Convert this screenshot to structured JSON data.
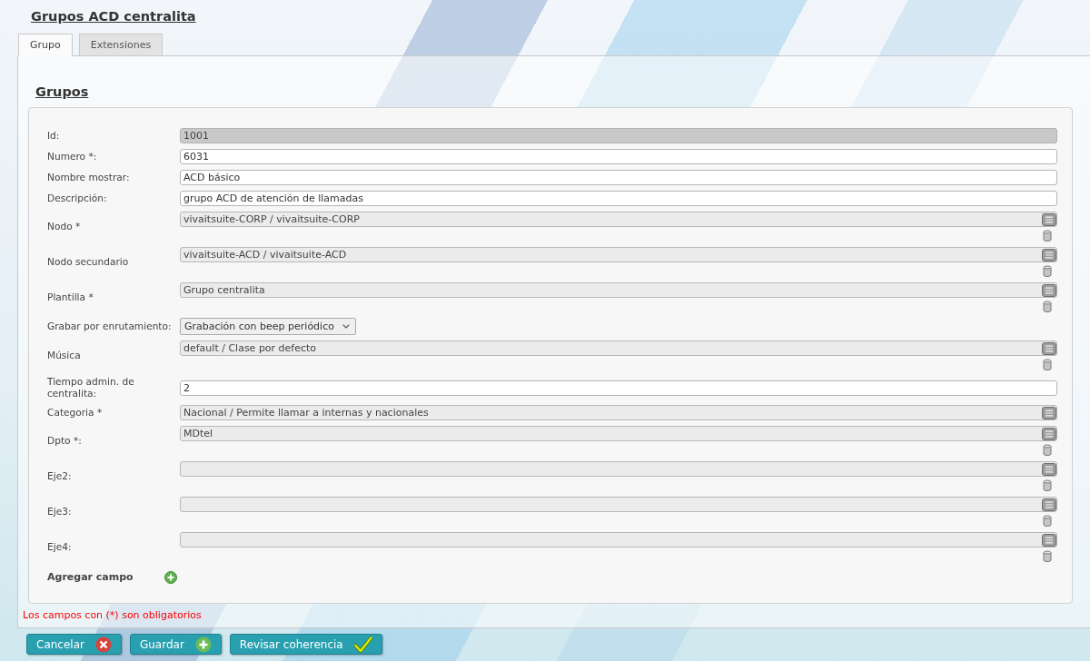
{
  "page": {
    "title": "Grupos ACD centralita"
  },
  "tabs": [
    {
      "label": "Grupo",
      "selected": true
    },
    {
      "label": "Extensiones",
      "selected": false
    }
  ],
  "section": {
    "title": "Grupos"
  },
  "fields": [
    {
      "kind": "text",
      "label": "Id:",
      "value": "1001",
      "disabled": true
    },
    {
      "kind": "text",
      "label": "Numero *:",
      "value": "6031",
      "disabled": false
    },
    {
      "kind": "text",
      "label": "Nombre mostrar:",
      "value": "ACD básico",
      "disabled": false
    },
    {
      "kind": "text",
      "label": "Descripción:",
      "value": "grupo ACD de atención de llamadas",
      "disabled": false
    },
    {
      "kind": "picker",
      "label": "Nodo *",
      "value": "vivaitsuite-CORP / vivaitsuite-CORP",
      "removable": true
    },
    {
      "kind": "picker",
      "label": "Nodo secundario",
      "value": "vivaitsuite-ACD / vivaitsuite-ACD",
      "removable": true
    },
    {
      "kind": "picker",
      "label": "Plantilla *",
      "value": "Grupo centralita",
      "removable": true
    },
    {
      "kind": "select",
      "label": "Grabar por enrutamiento:",
      "value": "Grabación con beep periódico"
    },
    {
      "kind": "picker",
      "label": "Música",
      "value": "default / Clase por defecto",
      "removable": true
    },
    {
      "kind": "text",
      "label": "Tiempo admin. de centralita:",
      "value": "2",
      "disabled": false
    },
    {
      "kind": "picker",
      "label": "Categoria *",
      "value": "Nacional / Permite llamar a internas y nacionales",
      "removable": false
    },
    {
      "kind": "picker",
      "label": "Dpto *:",
      "value": "MDtel",
      "removable": true
    },
    {
      "kind": "picker",
      "label": "Eje2:",
      "removable": true
    },
    {
      "kind": "picker",
      "label": "Eje3:",
      "removable": true
    },
    {
      "kind": "picker",
      "label": "Eje4:",
      "removable": true
    }
  ],
  "add_field": {
    "label": "Agregar campo"
  },
  "required_note": "Los campos con (*) son obligatorios",
  "buttons": [
    {
      "kind": "cancel",
      "label": "Cancelar"
    },
    {
      "kind": "save",
      "label": "Guardar"
    },
    {
      "kind": "check",
      "label": "Revisar coherencia"
    }
  ]
}
